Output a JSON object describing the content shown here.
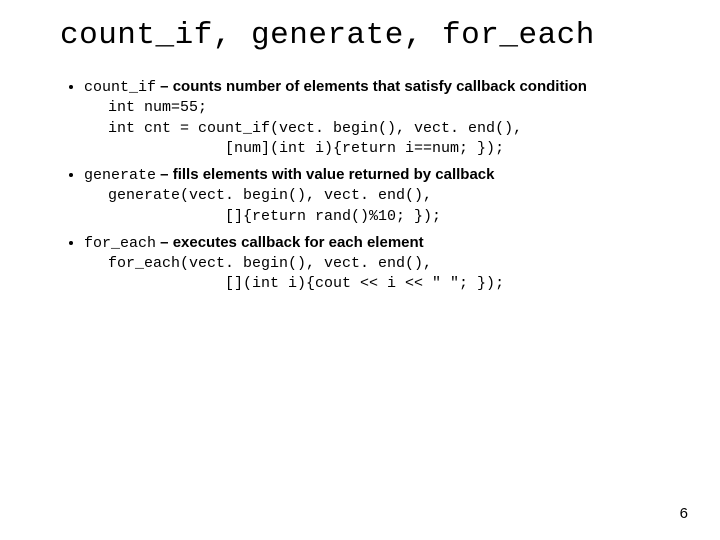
{
  "title": "count_if, generate, for_each",
  "bullets": [
    {
      "term": "count_if",
      "desc": " – counts number of elements that satisfy callback condition",
      "code": "int num=55;\nint cnt = count_if(vect. begin(), vect. end(),\n             [num](int i){return i==num; });"
    },
    {
      "term": "generate",
      "desc": " – fills elements with value returned by callback",
      "code": "generate(vect. begin(), vect. end(),\n             []{return rand()%10; });"
    },
    {
      "term": "for_each",
      "desc": " – executes callback for each element",
      "code": "for_each(vect. begin(), vect. end(),\n             [](int i){cout << i << \" \"; });"
    }
  ],
  "pagenum": "6"
}
